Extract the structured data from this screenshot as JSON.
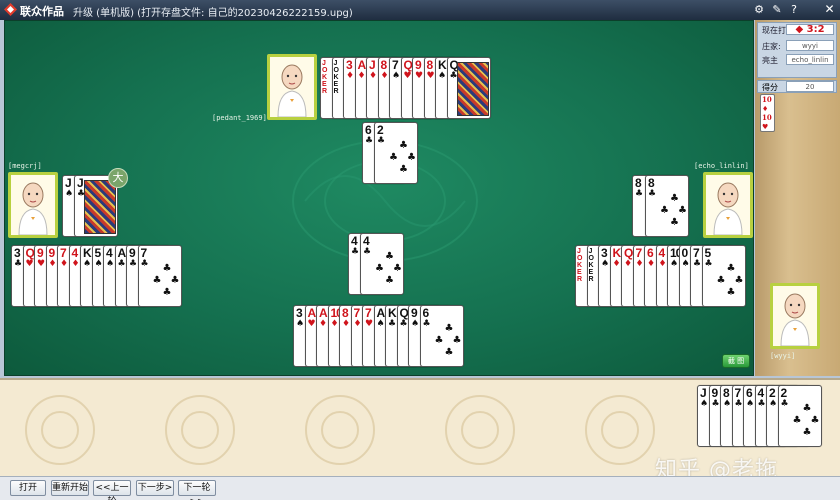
{
  "window": {
    "brand": "联众作品",
    "title": "升级 (单机版) (打开存盘文件: 自己的20230426222159.upg)"
  },
  "info": {
    "current_label": "现在打",
    "current_value": "◆ 3:2",
    "dealer_label": "庄家:",
    "dealer_value": "wyyi",
    "host_label": "亮主",
    "host_value": "echo_linlin",
    "score_label": "得分",
    "score_value": "20"
  },
  "side_cards": [
    "10",
    "10"
  ],
  "players": {
    "top": "[pedant_1969]",
    "left": "[megcrj]",
    "right": "[echo_linlin]",
    "bottom": "[wyyi]"
  },
  "badge": "大",
  "round_button": "截 图",
  "buttons": [
    "打开",
    "重新开始",
    "<<上一轮",
    "下一步>",
    "下一轮>>"
  ],
  "watermark": "知乎 @老拖",
  "hands": {
    "top_hand": [
      {
        "r": "JOKER",
        "c": "red",
        "j": true
      },
      {
        "r": "JOKER",
        "c": "blk",
        "j": true
      },
      {
        "r": "3",
        "c": "red",
        "s": "♦"
      },
      {
        "r": "A",
        "c": "red",
        "s": "♦"
      },
      {
        "r": "J",
        "c": "red",
        "s": "♦"
      },
      {
        "r": "8",
        "c": "red",
        "s": "♦"
      },
      {
        "r": "7",
        "c": "blk",
        "s": "♠"
      },
      {
        "r": "Q",
        "c": "red",
        "s": "♥"
      },
      {
        "r": "9",
        "c": "red",
        "s": "♥"
      },
      {
        "r": "8",
        "c": "red",
        "s": "♥"
      },
      {
        "r": "K",
        "c": "blk",
        "s": "♠"
      },
      {
        "r": "Q",
        "c": "blk",
        "s": "♣",
        "f": true
      }
    ],
    "top_play": [
      {
        "r": "6",
        "c": "blk",
        "s": "♣"
      },
      {
        "r": "2",
        "c": "blk",
        "s": "♣"
      }
    ],
    "left_play": [
      {
        "r": "J",
        "c": "blk",
        "s": "♠"
      },
      {
        "r": "J",
        "c": "blk",
        "s": "♣",
        "f": true
      }
    ],
    "left_hand": [
      {
        "r": "3",
        "c": "blk",
        "s": "♣"
      },
      {
        "r": "Q",
        "c": "red",
        "s": "♥"
      },
      {
        "r": "9",
        "c": "red",
        "s": "♥"
      },
      {
        "r": "9",
        "c": "red",
        "s": "♦"
      },
      {
        "r": "7",
        "c": "red",
        "s": "♦"
      },
      {
        "r": "4",
        "c": "red",
        "s": "♦"
      },
      {
        "r": "K",
        "c": "blk",
        "s": "♠"
      },
      {
        "r": "5",
        "c": "blk",
        "s": "♠"
      },
      {
        "r": "4",
        "c": "blk",
        "s": "♠"
      },
      {
        "r": "A",
        "c": "blk",
        "s": "♣"
      },
      {
        "r": "9",
        "c": "blk",
        "s": "♣"
      },
      {
        "r": "7",
        "c": "blk",
        "s": "♣"
      }
    ],
    "right_play": [
      {
        "r": "8",
        "c": "blk",
        "s": "♣"
      },
      {
        "r": "8",
        "c": "blk",
        "s": "♣"
      }
    ],
    "right_hand": [
      {
        "r": "JOKER",
        "c": "red",
        "j": true
      },
      {
        "r": "JOKER",
        "c": "blk",
        "j": true
      },
      {
        "r": "3",
        "c": "blk",
        "s": "♠"
      },
      {
        "r": "K",
        "c": "red",
        "s": "♦"
      },
      {
        "r": "Q",
        "c": "red",
        "s": "♦"
      },
      {
        "r": "7",
        "c": "red",
        "s": "♦"
      },
      {
        "r": "6",
        "c": "red",
        "s": "♦"
      },
      {
        "r": "4",
        "c": "red",
        "s": "♦"
      },
      {
        "r": "10",
        "c": "blk",
        "s": "♠"
      },
      {
        "r": "0",
        "c": "blk",
        "s": "♠"
      },
      {
        "r": "7",
        "c": "blk",
        "s": "♣"
      },
      {
        "r": "5",
        "c": "blk",
        "s": "♣"
      }
    ],
    "center_play": [
      {
        "r": "4",
        "c": "blk",
        "s": "♣"
      },
      {
        "r": "4",
        "c": "blk",
        "s": "♣"
      }
    ],
    "bottom_hand": [
      {
        "r": "3",
        "c": "blk",
        "s": "♠"
      },
      {
        "r": "A",
        "c": "red",
        "s": "♥"
      },
      {
        "r": "A",
        "c": "red",
        "s": "♦"
      },
      {
        "r": "10",
        "c": "red",
        "s": "♦"
      },
      {
        "r": "8",
        "c": "red",
        "s": "♦"
      },
      {
        "r": "7",
        "c": "red",
        "s": "♦"
      },
      {
        "r": "7",
        "c": "red",
        "s": "♥"
      },
      {
        "r": "A",
        "c": "blk",
        "s": "♠"
      },
      {
        "r": "K",
        "c": "blk",
        "s": "♣"
      },
      {
        "r": "Q",
        "c": "blk",
        "s": "♣"
      },
      {
        "r": "9",
        "c": "blk",
        "s": "♠"
      },
      {
        "r": "6",
        "c": "blk",
        "s": "♣"
      }
    ],
    "kitty": [
      {
        "r": "J",
        "c": "blk",
        "s": "♠"
      },
      {
        "r": "9",
        "c": "blk",
        "s": "♣"
      },
      {
        "r": "8",
        "c": "blk",
        "s": "♠"
      },
      {
        "r": "7",
        "c": "blk",
        "s": "♣"
      },
      {
        "r": "6",
        "c": "blk",
        "s": "♠"
      },
      {
        "r": "4",
        "c": "blk",
        "s": "♣"
      },
      {
        "r": "2",
        "c": "blk",
        "s": "♠"
      },
      {
        "r": "2",
        "c": "blk",
        "s": "♣"
      }
    ]
  }
}
